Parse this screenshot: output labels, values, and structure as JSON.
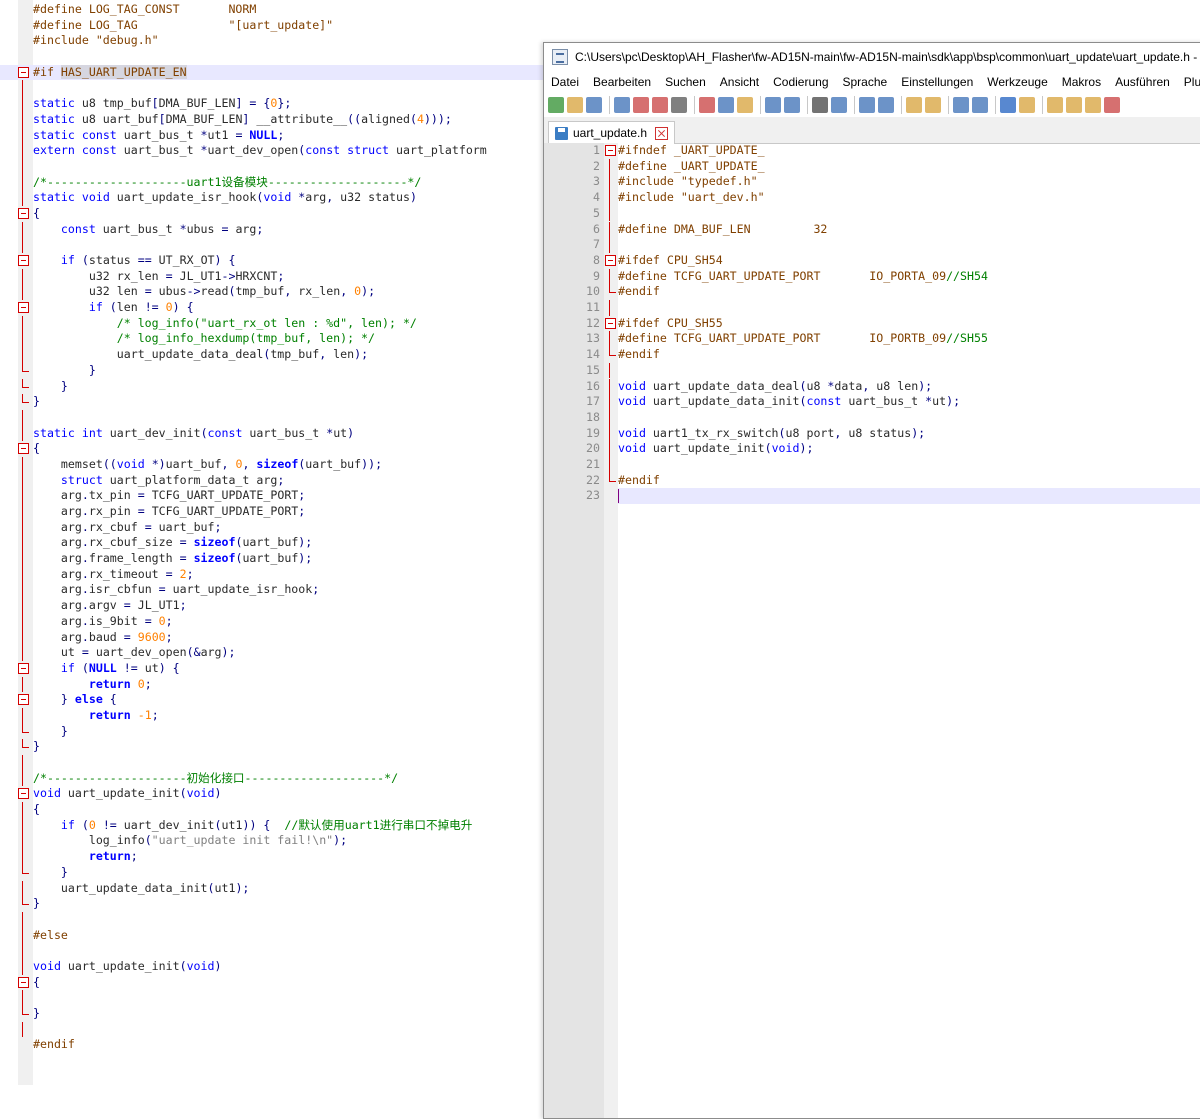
{
  "window": {
    "title": "C:\\Users\\pc\\Desktop\\AH_Flasher\\fw-AD15N-main\\fw-AD15N-main\\sdk\\app\\bsp\\common\\uart_update\\uart_update.h -",
    "menu": [
      "Datei",
      "Bearbeiten",
      "Suchen",
      "Ansicht",
      "Codierung",
      "Sprache",
      "Einstellungen",
      "Werkzeuge",
      "Makros",
      "Ausführen",
      "Plugins"
    ],
    "toolbar_icons": [
      "new-file-icon",
      "open-file-icon",
      "save-icon",
      "save-all-icon",
      "close-icon",
      "close-all-icon",
      "print-icon",
      "cut-icon",
      "copy-icon",
      "paste-icon",
      "undo-icon",
      "redo-icon",
      "find-icon",
      "replace-icon",
      "zoom-in-icon",
      "zoom-out-icon",
      "sync-vertical-icon",
      "sync-horizontal-icon",
      "word-wrap-icon",
      "show-all-characters-icon",
      "indent-guide-icon",
      "user-language-icon",
      "doc-map-icon",
      "function-list-icon",
      "folder-workspace-icon",
      "record-macro-icon"
    ],
    "tab": "uart_update.h"
  },
  "background_lines": [
    "#define LOG_TAG_CONST       NORM",
    "#define LOG_TAG             \"[uart_update]\"",
    "#include \"debug.h\"",
    "",
    "#if HAS_UART_UPDATE_EN",
    "",
    "static u8 tmp_buf[DMA_BUF_LEN] = {0};",
    "static u8 uart_buf[DMA_BUF_LEN] __attribute__((aligned(4)));",
    "static const uart_bus_t *ut1 = NULL;",
    "extern const uart_bus_t *uart_dev_open(const struct uart_platform",
    "",
    "/*--------------------uart1设备模块--------------------*/",
    "static void uart_update_isr_hook(void *arg, u32 status)",
    "{",
    "    const uart_bus_t *ubus = arg;",
    "",
    "    if (status == UT_RX_OT) {",
    "        u32 rx_len = JL_UT1->HRXCNT;",
    "        u32 len = ubus->read(tmp_buf, rx_len, 0);",
    "        if (len != 0) {",
    "            /* log_info(\"uart_rx_ot len : %d\", len); */",
    "            /* log_info_hexdump(tmp_buf, len); */",
    "            uart_update_data_deal(tmp_buf, len);",
    "        }",
    "    }",
    "}",
    "",
    "static int uart_dev_init(const uart_bus_t *ut)",
    "{",
    "    memset((void *)uart_buf, 0, sizeof(uart_buf));",
    "    struct uart_platform_data_t arg;",
    "    arg.tx_pin = TCFG_UART_UPDATE_PORT;",
    "    arg.rx_pin = TCFG_UART_UPDATE_PORT;",
    "    arg.rx_cbuf = uart_buf;",
    "    arg.rx_cbuf_size = sizeof(uart_buf);",
    "    arg.frame_length = sizeof(uart_buf);",
    "    arg.rx_timeout = 2;",
    "    arg.isr_cbfun = uart_update_isr_hook;",
    "    arg.argv = JL_UT1;",
    "    arg.is_9bit = 0;",
    "    arg.baud = 9600;",
    "    ut = uart_dev_open(&arg);",
    "    if (NULL != ut) {",
    "        return 0;",
    "    } else {",
    "        return -1;",
    "    }",
    "}",
    "",
    "/*--------------------初始化接口--------------------*/",
    "void uart_update_init(void)",
    "{",
    "    if (0 != uart_dev_init(ut1)) {  //默认使用uart1进行串口不掉电升",
    "        log_info(\"uart_update init fail!\\n\");",
    "        return;",
    "    }",
    "    uart_update_data_init(ut1);",
    "}",
    "",
    "#else",
    "",
    "void uart_update_init(void)",
    "{",
    "",
    "}",
    "",
    "#endif"
  ],
  "editor_lines": [
    "#ifndef _UART_UPDATE_",
    "#define _UART_UPDATE_",
    "#include \"typedef.h\"",
    "#include \"uart_dev.h\"",
    "",
    "#define DMA_BUF_LEN         32",
    "",
    "#ifdef CPU_SH54",
    "#define TCFG_UART_UPDATE_PORT       IO_PORTA_09//SH54",
    "#endif",
    "",
    "#ifdef CPU_SH55",
    "#define TCFG_UART_UPDATE_PORT       IO_PORTB_09//SH55",
    "#endif",
    "",
    "void uart_update_data_deal(u8 *data, u8 len);",
    "void uart_update_data_init(const uart_bus_t *ut);",
    "",
    "void uart1_tx_rx_switch(u8 port, u8 status);",
    "void uart_update_init(void);",
    "",
    "#endif",
    ""
  ],
  "line_numbers": [
    "1",
    "2",
    "3",
    "4",
    "5",
    "6",
    "7",
    "8",
    "9",
    "10",
    "11",
    "12",
    "13",
    "14",
    "15",
    "16",
    "17",
    "18",
    "19",
    "20",
    "21",
    "22",
    "23"
  ]
}
